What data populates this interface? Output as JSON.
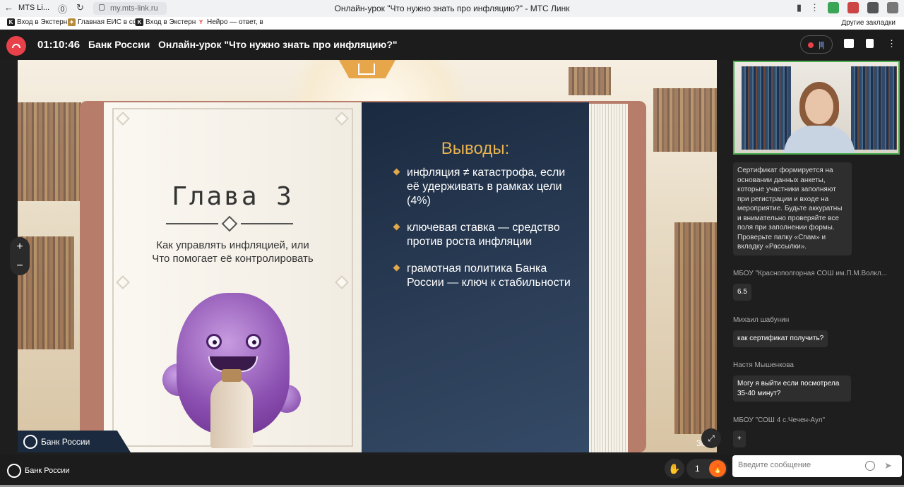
{
  "browser": {
    "tab_title": "MTS Li...",
    "url": "my.mts-link.ru",
    "page_title": "Онлайн-урок \"Что нужно знать про инфляцию?\" - МТС Линк",
    "bookmarks": [
      "Вход в Экстерн",
      "Главная ЕИС в сф",
      "Вход в Экстерн",
      "Нейро — ответ, в"
    ],
    "other_bookmarks": "Другие закладки"
  },
  "header": {
    "timer": "01:10:46",
    "organizer": "Банк России",
    "lesson_title": "Онлайн-урок \"Что нужно знать про инфляцию?\""
  },
  "slide": {
    "chapter": "Глава 3",
    "chapter_subtitle": "Как управлять инфляцией, или Что помогает её контролировать",
    "findings_title": "Выводы:",
    "findings": [
      "инфляция ≠ катастрофа, если её удерживать в рамках цели (4%)",
      "ключевая ставка — средство против роста инфляции",
      "грамотная политика Банка России — ключ к стабильности"
    ],
    "brand": "Банк России",
    "page_number": "38"
  },
  "zoom": {
    "in": "+",
    "out": "−"
  },
  "chat": {
    "messages": [
      {
        "author": "",
        "text": "Сертификат формируется на основании данных анкеты, которые участники заполняют при регистрации и входе на мероприятие. Будьте аккуратны и внимательно проверяйте все поля при заполнении формы. Проверьте папку «Спам» и вкладку «Рассылки»."
      },
      {
        "author": "МБОУ \"Краснополгорная СОШ им.П.М.Волкл...",
        "text": "6.5"
      },
      {
        "author": "Михаил шабунин",
        "text": "как сертификат получить?"
      },
      {
        "author": "Настя Мышенкова",
        "text": "Могу я выйти если посмотрела 35-40 минут?"
      },
      {
        "author": "МБОУ \"СОШ 4 с.Чечен-Аул\"",
        "text": "+"
      }
    ]
  },
  "bottom": {
    "brand": "Банк России",
    "reaction_count": "1",
    "message_placeholder": "Введите сообщение"
  },
  "colors": {
    "accent_red": "#e8414a",
    "gold": "#e8b24e",
    "video_border": "#4caf50"
  }
}
